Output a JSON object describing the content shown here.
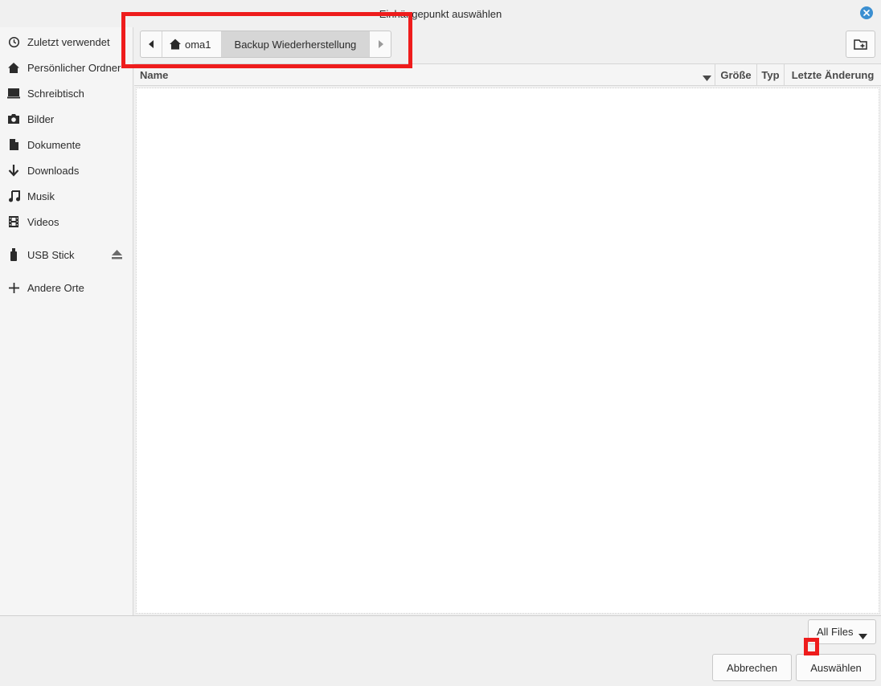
{
  "window": {
    "title": "Einhängepunkt auswählen"
  },
  "sidebar": {
    "items": [
      {
        "label": "Zuletzt verwendet",
        "icon": "clock-icon"
      },
      {
        "label": "Persönlicher Ordner",
        "icon": "home-icon"
      },
      {
        "label": "Schreibtisch",
        "icon": "desktop-icon"
      },
      {
        "label": "Bilder",
        "icon": "camera-icon"
      },
      {
        "label": "Dokumente",
        "icon": "document-icon"
      },
      {
        "label": "Downloads",
        "icon": "download-icon"
      },
      {
        "label": "Musik",
        "icon": "music-icon"
      },
      {
        "label": "Videos",
        "icon": "film-icon"
      },
      {
        "label": "USB Stick",
        "icon": "usb-icon"
      },
      {
        "label": "Andere Orte",
        "icon": "plus-icon"
      }
    ]
  },
  "pathbar": {
    "segments": [
      "oma1",
      "Backup Wiederherstellung"
    ]
  },
  "list": {
    "columns": {
      "name": "Name",
      "size": "Größe",
      "type": "Typ",
      "modified": "Letzte Änderung"
    },
    "rows": []
  },
  "footer": {
    "filter_value": "All Files",
    "cancel_label": "Abbrechen",
    "select_label": "Auswählen"
  },
  "colors": {
    "accent": "#3b8fd1",
    "highlight": "#ee1c1c"
  }
}
